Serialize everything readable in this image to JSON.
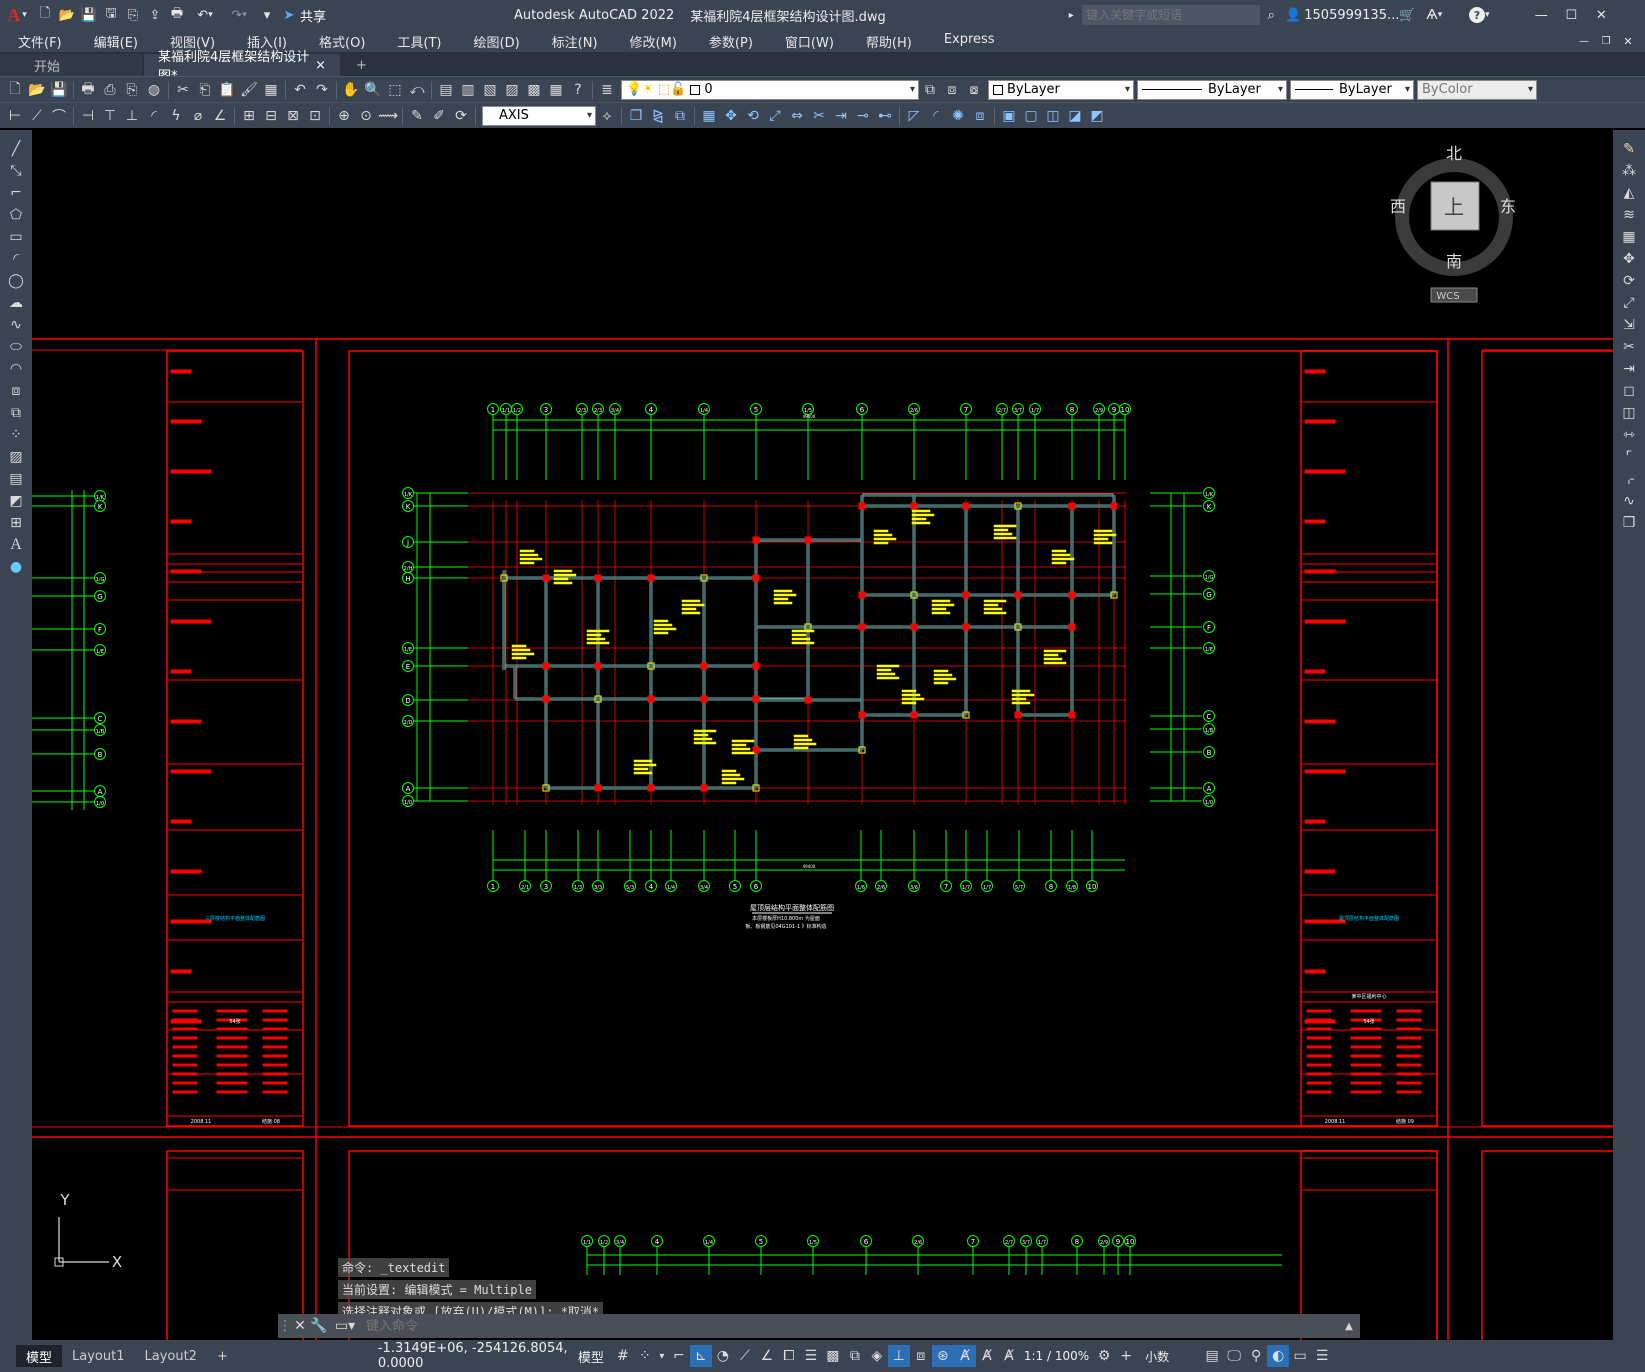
{
  "app": {
    "logo": "A",
    "title": "Autodesk AutoCAD 2022",
    "filename": "某福利院4层框架结构设计图.dwg",
    "share": "共享",
    "search_placeholder": "键入关键字或短语",
    "user": "1505999135...",
    "help": "?"
  },
  "menu": [
    "文件(F)",
    "编辑(E)",
    "视图(V)",
    "插入(I)",
    "格式(O)",
    "工具(T)",
    "绘图(D)",
    "标注(N)",
    "修改(M)",
    "参数(P)",
    "窗口(W)",
    "帮助(H)",
    "Express"
  ],
  "tabs": {
    "start": "开始",
    "active": "某福利院4层框架结构设计图*",
    "close": "×",
    "add": "+"
  },
  "toolbar": {
    "layer": "0",
    "color": "ByLayer",
    "linetype": "ByLayer",
    "lineweight": "ByLayer",
    "plotstyle": "ByColor",
    "dimstyle": "AXIS"
  },
  "viewcube": {
    "north": "北",
    "south": "南",
    "east": "东",
    "west": "西",
    "face": "上",
    "wcs": "WCS"
  },
  "drawing": {
    "grid_top": [
      "1",
      "1/1",
      "1/2",
      "3",
      "2/3",
      "2/3",
      "3/4",
      "4",
      "1/4",
      "5",
      "1/5",
      "6",
      "2/6",
      "7",
      "2/7",
      "3/7",
      "1/7",
      "8",
      "2/9",
      "9",
      "10"
    ],
    "grid_bottom": [
      "1",
      "2/1",
      "3",
      "1/3",
      "3/3",
      "5/3",
      "4",
      "1/4",
      "3/4",
      "5",
      "6",
      "1/6",
      "2/6",
      "3/6",
      "7",
      "1/7",
      "1/7",
      "5/7",
      "8",
      "1/8",
      "10"
    ],
    "grid_left": [
      "1/K",
      "K",
      "J",
      "2/H",
      "H",
      "1/E",
      "E",
      "D",
      "2/D",
      "A",
      "1/0"
    ],
    "grid_right": [
      "1/K",
      "K",
      "1/G",
      "G",
      "F",
      "1/E",
      "C",
      "1/B",
      "B",
      "A",
      "1/0"
    ],
    "small_left": [
      "1/K",
      "K",
      "1/G",
      "G",
      "F",
      "1/E",
      "C",
      "1/B",
      "B",
      "A",
      "1/0"
    ],
    "dim_total": "49400",
    "drawing_title": "屋顶层结构平面整体配筋图",
    "note1": "本层楼板厚H10.800m 为屋面",
    "note2": "板、板钢筋见04G101-1 》标准构造",
    "left_sheet": {
      "title": "三层楼结构平面整体配筋图",
      "project": "54张",
      "date": "2008.11",
      "sheet": "结施 08"
    },
    "right_sheet": {
      "title": "屋顶层结构平面整体配筋图",
      "client": "某中区福利中心",
      "project": "54张",
      "date": "2008.11",
      "sheet": "结施 09"
    },
    "bottom_grid": [
      "1/1",
      "1/2",
      "3/4",
      "4",
      "1/4",
      "5",
      "1/5",
      "6",
      "2/6",
      "7",
      "2/7",
      "3/7",
      "1/7",
      "8",
      "2/9",
      "9",
      "10"
    ]
  },
  "ucs": {
    "x": "X",
    "y": "Y"
  },
  "commands": [
    "命令: _textedit",
    "当前设置: 编辑模式 = Multiple",
    "选择注释对象或 [放弃(U)/模式(M)]: *取消*"
  ],
  "cmd_placeholder": "键入命令",
  "layouts": [
    "模型",
    "Layout1",
    "Layout2"
  ],
  "status": {
    "coords": "-1.3149E+06, -254126.8054, 0.0000",
    "model": "模型",
    "scale": "1:1 / 100%",
    "units": "小数"
  },
  "colors": {
    "bg": "#000000",
    "frame": "#ff0000",
    "grid": "#00ff00",
    "beam": "#6aa7a7",
    "label": "#ffff00",
    "ui": "#3b4453"
  }
}
